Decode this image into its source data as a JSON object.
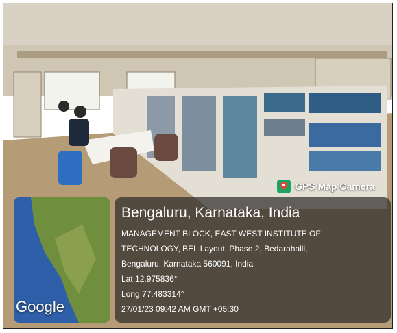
{
  "badge": {
    "label": "GPS Map Camera",
    "icon": "gps-map-camera-icon"
  },
  "location": {
    "city_line": "Bengaluru, Karnataka, India",
    "address_line1": "MANAGEMENT BLOCK, EAST WEST INSTITUTE OF",
    "address_line2": "TECHNOLOGY, BEL Layout, Phase 2, Bedarahalli,",
    "address_line3": "Bengaluru, Karnataka 560091, India",
    "lat": "Lat 12.975836°",
    "long": "Long 77.483314°",
    "datetime": "27/01/23 09:42 AM GMT +05:30"
  },
  "map": {
    "watermark": "Google"
  },
  "colors": {
    "panel": "#282828",
    "gps_green": "#1aa260",
    "pin_red": "#ea4335",
    "water": "#2f5fa8",
    "land": "#6f8f3f"
  }
}
